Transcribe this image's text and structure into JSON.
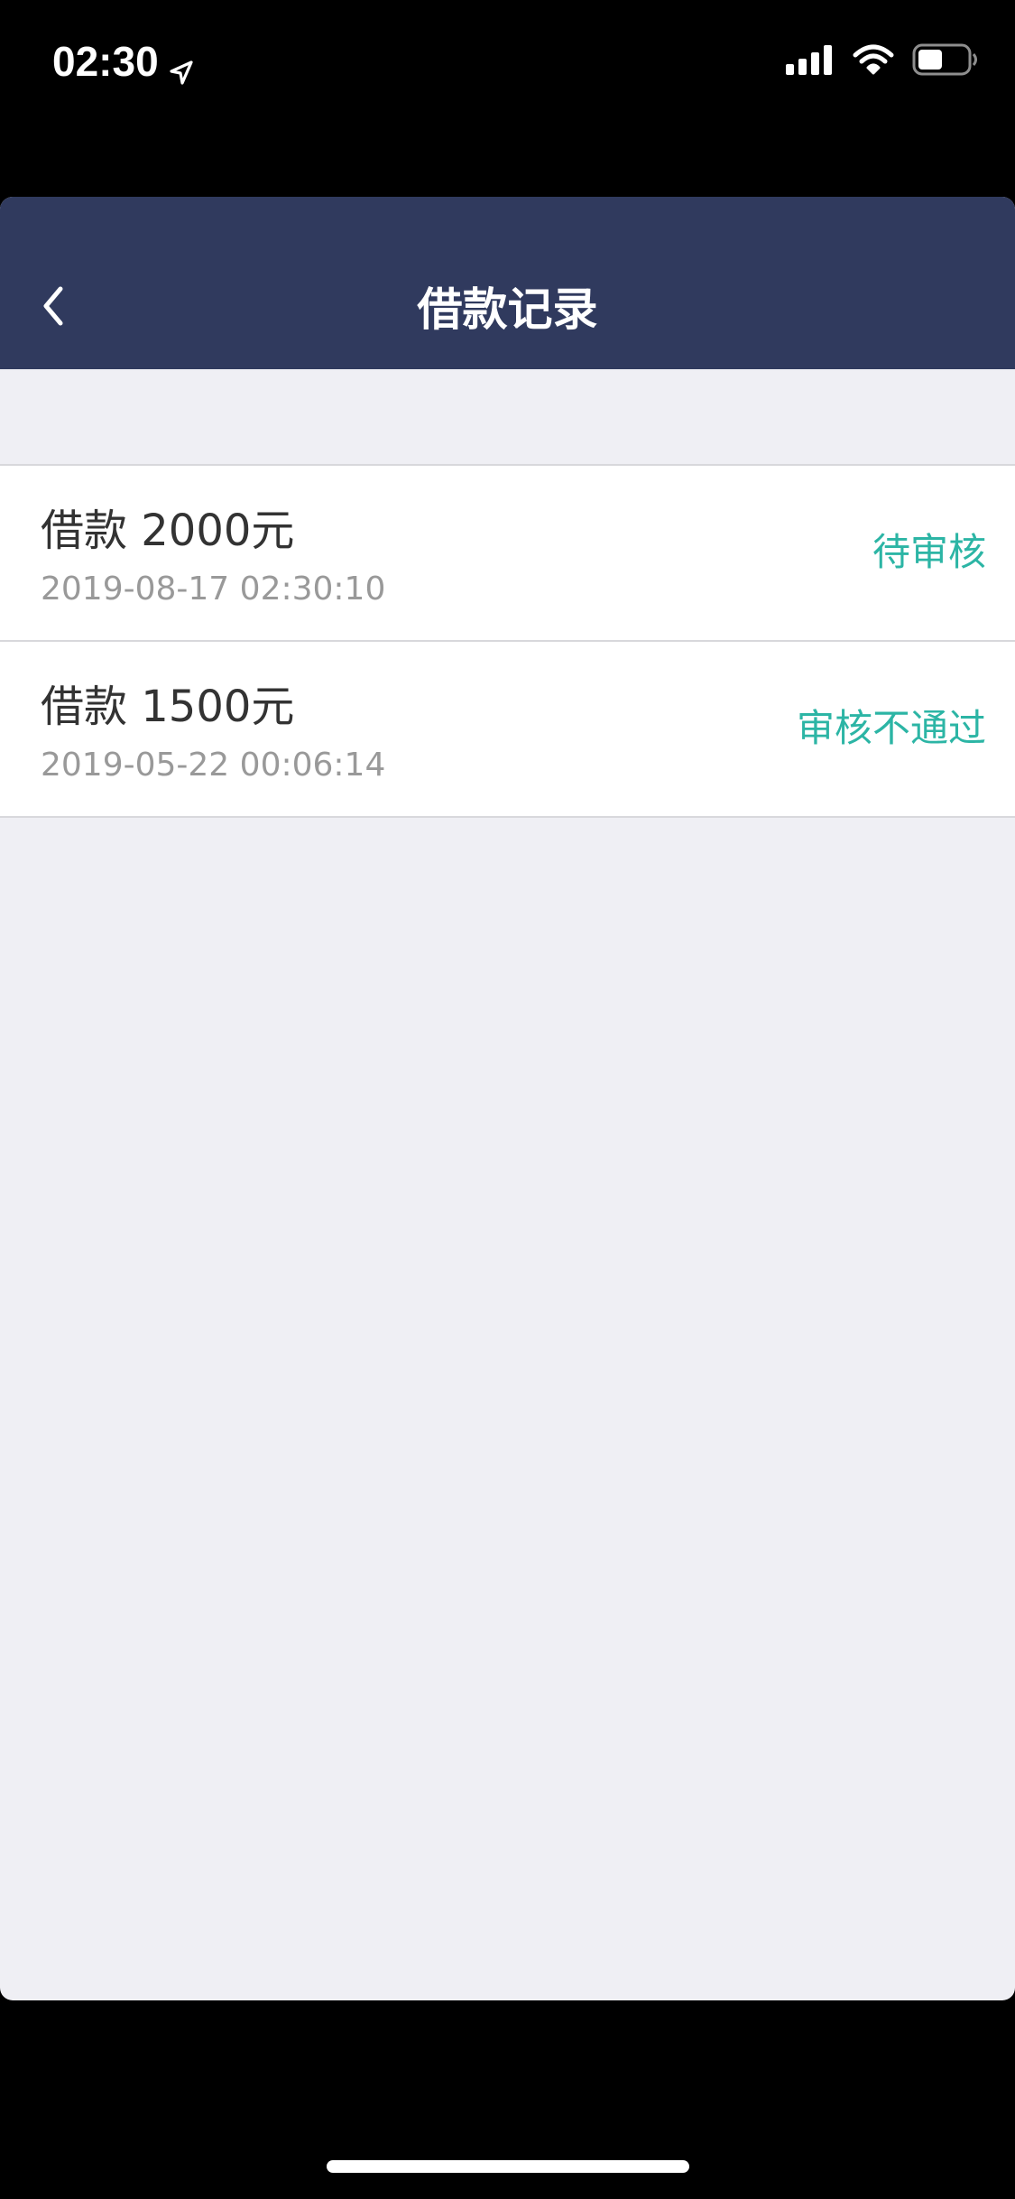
{
  "status_bar": {
    "time": "02:30",
    "icons": [
      "location-arrow-icon",
      "cellular-signal-icon",
      "wifi-icon",
      "battery-icon"
    ]
  },
  "nav": {
    "title": "借款记录",
    "back_icon": "chevron-left-icon"
  },
  "records": [
    {
      "title": "借款 2000元",
      "time": "2019-08-17 02:30:10",
      "status": "待审核"
    },
    {
      "title": "借款 1500元",
      "time": "2019-05-22 00:06:14",
      "status": "审核不通过"
    }
  ],
  "colors": {
    "nav_background": "#303a5e",
    "page_background": "#efeff4",
    "status_text": "#2cb5a5",
    "title_text": "#333333",
    "time_text": "#999999"
  }
}
